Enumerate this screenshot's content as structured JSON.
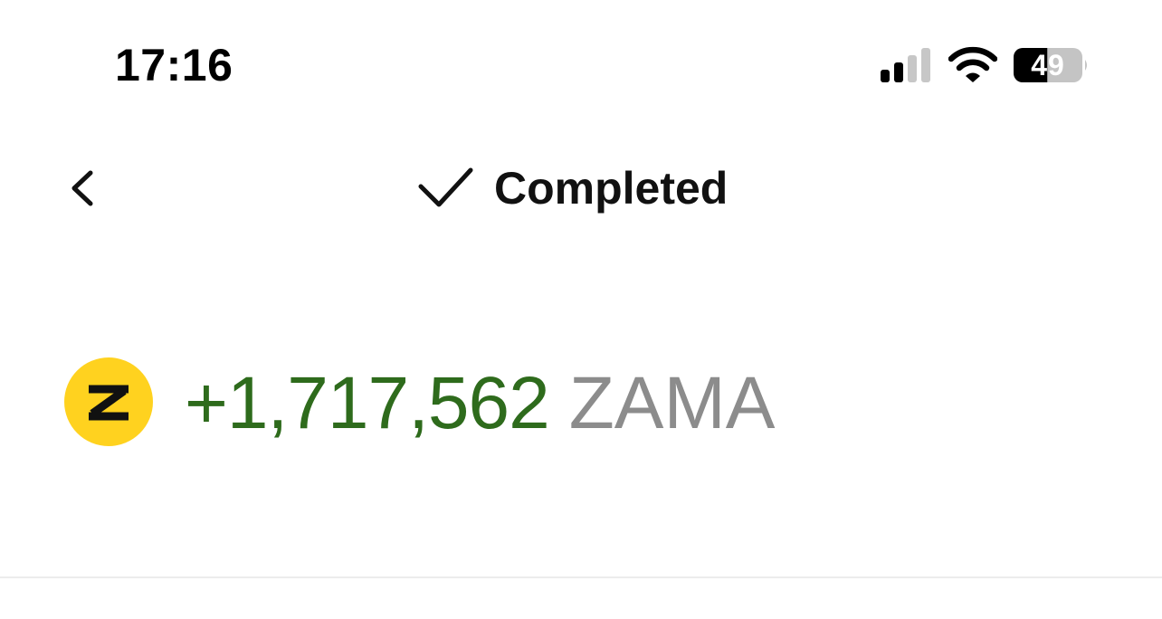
{
  "status_bar": {
    "time": "17:16",
    "battery_level": "49",
    "icons": [
      "signal-icon",
      "wifi-icon",
      "battery-icon"
    ]
  },
  "header": {
    "back_icon": "chevron-left-icon",
    "status_icon": "checkmark-icon",
    "title": "Completed"
  },
  "transaction": {
    "token_icon": "zama-token-icon",
    "token_badge_letter": "Z",
    "amount": "+1,717,562",
    "symbol": "ZAMA"
  },
  "colors": {
    "amount_positive": "#2e6b1c",
    "symbol_gray": "#8c8c8c",
    "token_yellow": "#ffd21f",
    "divider": "#ececec"
  }
}
